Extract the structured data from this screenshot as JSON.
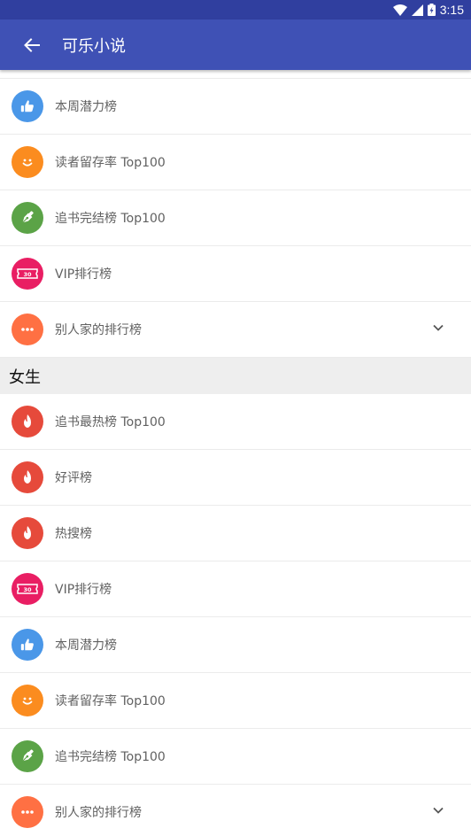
{
  "status_bar": {
    "time": "3:15"
  },
  "app_bar": {
    "title": "可乐小说"
  },
  "sections": [
    {
      "items": [
        {
          "label": "本周潜力榜",
          "icon": "thumbs-up-icon",
          "color": "#4a97e8"
        },
        {
          "label": "读者留存率 Top100",
          "icon": "smile-icon",
          "color": "#fb8c1f"
        },
        {
          "label": "追书完结榜 Top100",
          "icon": "pen-nib-icon",
          "color": "#5ba347"
        },
        {
          "label": "VIP排行榜",
          "icon": "ticket-icon",
          "color": "#e91e63"
        },
        {
          "label": "别人家的排行榜",
          "icon": "more-icon",
          "color": "#ff7043",
          "expandable": true
        }
      ]
    },
    {
      "title": "女生",
      "items": [
        {
          "label": "追书最热榜 Top100",
          "icon": "flame-icon",
          "color": "#e64a3b"
        },
        {
          "label": "好评榜",
          "icon": "flame-icon",
          "color": "#e64a3b"
        },
        {
          "label": "热搜榜",
          "icon": "flame-icon",
          "color": "#e64a3b"
        },
        {
          "label": "VIP排行榜",
          "icon": "ticket-icon",
          "color": "#e91e63"
        },
        {
          "label": "本周潜力榜",
          "icon": "thumbs-up-icon",
          "color": "#4a97e8"
        },
        {
          "label": "读者留存率 Top100",
          "icon": "smile-icon",
          "color": "#fb8c1f"
        },
        {
          "label": "追书完结榜 Top100",
          "icon": "pen-nib-icon",
          "color": "#5ba347"
        },
        {
          "label": "别人家的排行榜",
          "icon": "more-icon",
          "color": "#ff7043",
          "expandable": true
        }
      ]
    }
  ]
}
